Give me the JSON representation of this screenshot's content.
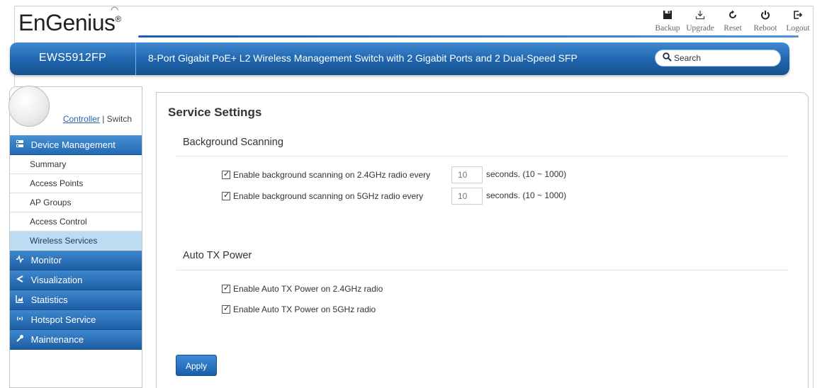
{
  "header": {
    "logo_text": "EnGenius",
    "logo_mark": "®",
    "tools": [
      {
        "label": "Backup",
        "icon": "save-icon"
      },
      {
        "label": "Upgrade",
        "icon": "download-icon"
      },
      {
        "label": "Reset",
        "icon": "reset-icon"
      },
      {
        "label": "Reboot",
        "icon": "power-icon"
      },
      {
        "label": "Logout",
        "icon": "logout-icon"
      }
    ]
  },
  "banner": {
    "model": "EWS5912FP",
    "description": "8-Port Gigabit PoE+ L2 Wireless Management Switch with 2 Gigabit Ports and 2 Dual-Speed SFP",
    "search_placeholder": "Search"
  },
  "sidebar": {
    "controller_label": "Controller",
    "separator": "|",
    "switch_label": "Switch",
    "groups": [
      {
        "label": "Device Management",
        "icon": "device-icon",
        "items": [
          "Summary",
          "Access Points",
          "AP Groups",
          "Access Control",
          "Wireless Services"
        ]
      },
      {
        "label": "Monitor",
        "icon": "monitor-icon"
      },
      {
        "label": "Visualization",
        "icon": "share-icon"
      },
      {
        "label": "Statistics",
        "icon": "chart-icon"
      },
      {
        "label": "Hotspot Service",
        "icon": "wireless-icon"
      },
      {
        "label": "Maintenance",
        "icon": "wrench-icon"
      }
    ],
    "active_item": "Wireless Services"
  },
  "main": {
    "title": "Service Settings",
    "background_scanning": {
      "heading": "Background Scanning",
      "rows": [
        {
          "label": "Enable background scanning on 2.4GHz radio every",
          "value": "10",
          "suffix": "seconds. (10 ~ 1000)",
          "checked": true
        },
        {
          "label": "Enable background scanning on 5GHz radio every",
          "value": "10",
          "suffix": "seconds. (10 ~ 1000)",
          "checked": true
        }
      ]
    },
    "auto_tx_power": {
      "heading": "Auto TX Power",
      "rows": [
        {
          "label": "Enable Auto TX Power on 2.4GHz radio",
          "checked": true
        },
        {
          "label": "Enable Auto TX Power on 5GHz radio",
          "checked": true
        }
      ]
    },
    "apply_label": "Apply"
  },
  "colors": {
    "brand_blue": "#1f64ad",
    "active_item_bg": "#bcdcf2"
  }
}
